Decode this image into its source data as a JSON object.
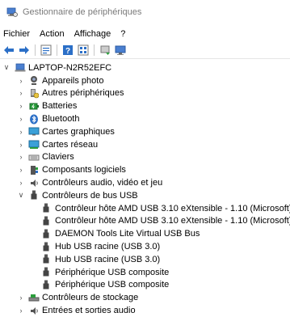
{
  "window": {
    "title": "Gestionnaire de périphériques"
  },
  "menu": [
    "Fichier",
    "Action",
    "Affichage",
    "?"
  ],
  "tree": {
    "computer": "LAPTOP-N2R52EFC",
    "categories": [
      {
        "label": "Appareils photo",
        "icon": "camera-icon"
      },
      {
        "label": "Autres périphériques",
        "icon": "unknown-device-icon"
      },
      {
        "label": "Batteries",
        "icon": "battery-icon"
      },
      {
        "label": "Bluetooth",
        "icon": "bluetooth-icon"
      },
      {
        "label": "Cartes graphiques",
        "icon": "display-adapter-icon"
      },
      {
        "label": "Cartes réseau",
        "icon": "network-adapter-icon"
      },
      {
        "label": "Claviers",
        "icon": "keyboard-icon"
      },
      {
        "label": "Composants logiciels",
        "icon": "software-component-icon"
      },
      {
        "label": "Contrôleurs audio, vidéo et jeu",
        "icon": "audio-icon"
      },
      {
        "label": "Contrôleurs de bus USB",
        "icon": "usb-icon"
      }
    ],
    "usb_children": [
      "Contrôleur hôte AMD USB 3.10 eXtensible - 1.10 (Microsoft)",
      "Contrôleur hôte AMD USB 3.10 eXtensible - 1.10 (Microsoft)",
      "DAEMON Tools Lite Virtual USB Bus",
      "Hub USB racine (USB 3.0)",
      "Hub USB racine (USB 3.0)",
      "Périphérique USB composite",
      "Périphérique USB composite"
    ],
    "after": [
      {
        "label": "Contrôleurs de stockage",
        "icon": "storage-controller-icon"
      },
      {
        "label": "Entrées et sorties audio",
        "icon": "audio-io-icon"
      }
    ]
  },
  "colors": {
    "blue": "#2b6fc7",
    "green": "#2a9d3c",
    "gray": "#606060"
  }
}
